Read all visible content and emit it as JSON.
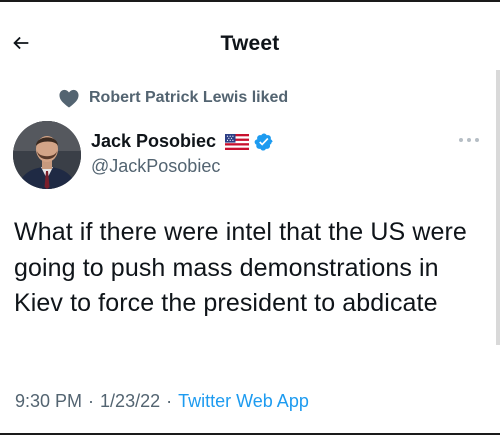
{
  "header": {
    "title": "Tweet",
    "back_icon": "arrow-left-icon"
  },
  "social_context": {
    "icon": "heart-icon",
    "text": "Robert Patrick Lewis liked"
  },
  "tweet": {
    "author": {
      "name": "Jack Posobiec",
      "handle": "@JackPosobiec",
      "flag_icon": "us-flag-icon",
      "verified_icon": "verified-badge-icon",
      "verified_color": "#1d9bf0"
    },
    "more_icon": "more-options-icon",
    "text": "What if there were intel that the US were going to push mass demonstrations in Kiev to force the president to abdicate",
    "time": "9:30 PM",
    "date": "1/23/22",
    "separator": "·",
    "source": "Twitter Web App"
  },
  "colors": {
    "primary_text": "#0f1419",
    "secondary_text": "#536471",
    "accent": "#1d9bf0"
  }
}
